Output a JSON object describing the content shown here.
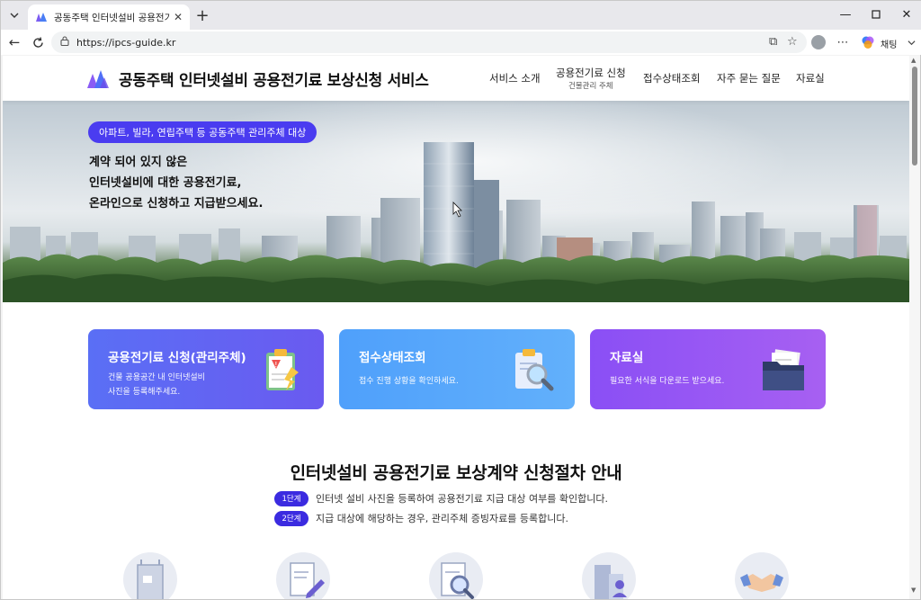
{
  "browser": {
    "tab_title": "공동주택 인터넷설비 공용전기료 보",
    "url": "https://ipcs-guide.kr",
    "chat_label": "채팅"
  },
  "header": {
    "title": "공동주택 인터넷설비 공용전기료 보상신청 서비스",
    "nav": [
      {
        "label": "서비스 소개"
      },
      {
        "label": "공용전기료 신청",
        "sub": "건물관리 주체"
      },
      {
        "label": "접수상태조회"
      },
      {
        "label": "자주 묻는 질문"
      },
      {
        "label": "자료실"
      }
    ]
  },
  "hero": {
    "pill": "아파트, 빌라, 연립주택 등 공동주택 관리주체 대상",
    "lines": [
      "계약 되어 있지 않은",
      "인터넷설비에 대한 공용전기료,",
      "온라인으로 신청하고 지급받으세요."
    ]
  },
  "cards": [
    {
      "title": "공용전기료 신청(관리주체)",
      "desc1": "건물 공용공간 내 인터넷설비",
      "desc2": "사진을 등록해주세요.",
      "color_from": "#5a6ff5",
      "color_to": "#6a5af0"
    },
    {
      "title": "접수상태조회",
      "desc1": "접수 진행 상황을 확인하세요.",
      "desc2": "",
      "color_from": "#4fa0fb",
      "color_to": "#62b0fb"
    },
    {
      "title": "자료실",
      "desc1": "필요한 서식을 다운로드 받으세요.",
      "desc2": "",
      "color_from": "#8a4ff5",
      "color_to": "#a760f2"
    }
  ],
  "procedure": {
    "title": "인터넷설비 공용전기료 보상계약 신청절차 안내",
    "steps": [
      {
        "badge": "1단계",
        "text": "인터넷 설비 사진을 등록하여 공용전기료 지급 대상 여부를 확인합니다."
      },
      {
        "badge": "2단계",
        "text": "지급 대상에 해당하는 경우, 관리주체 증빙자료를 등록합니다."
      }
    ]
  },
  "colors": {
    "accent": "#3b2be0",
    "pill": "#4a3cf0"
  }
}
